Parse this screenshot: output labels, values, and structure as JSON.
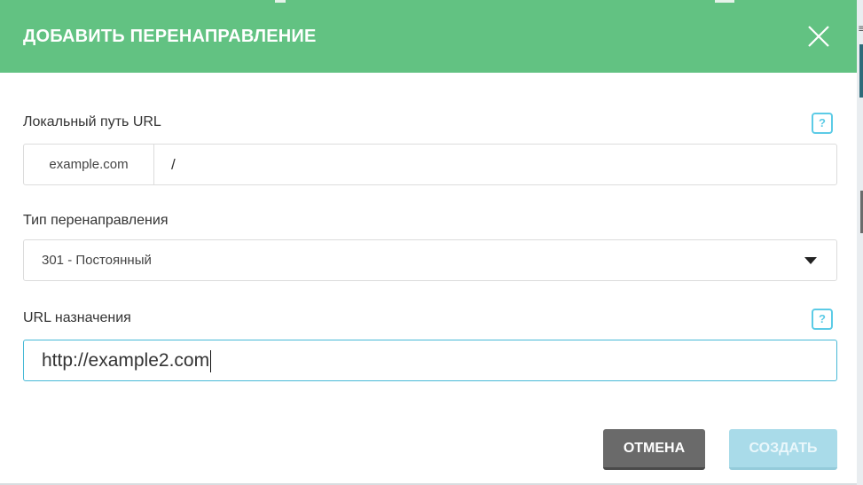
{
  "modal": {
    "title": "ДОБАВИТЬ ПЕРЕНАПРАВЛЕНИЕ",
    "close_icon": "close-x-icon"
  },
  "local_path": {
    "label": "Локальный путь URL",
    "prefix": "example.com",
    "value": "/",
    "help": "?"
  },
  "redirect_type": {
    "label": "Тип перенаправления",
    "selected": "301 - Постоянный"
  },
  "destination": {
    "label": "URL назначения",
    "value": "http://example2.com",
    "help": "?"
  },
  "buttons": {
    "cancel": "ОТМЕНА",
    "create": "СОЗДАТЬ"
  },
  "colors": {
    "header": "#62c282",
    "help_accent": "#5ccbe6",
    "focus_border": "#47b9d6",
    "cancel_bg": "#6a6a6a",
    "create_bg_disabled": "#a9dbe9"
  }
}
